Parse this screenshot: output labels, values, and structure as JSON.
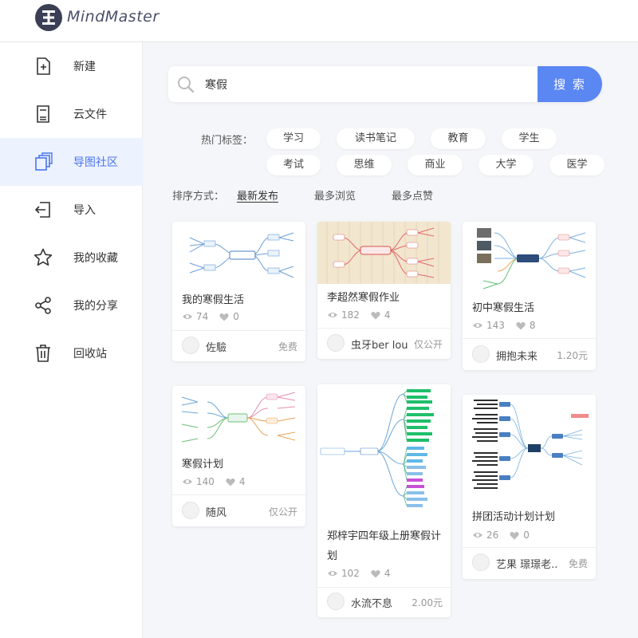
{
  "app": {
    "logo_text": "MindMaster"
  },
  "sidebar": {
    "items": [
      {
        "label": "新建",
        "icon": "new-file-icon"
      },
      {
        "label": "云文件",
        "icon": "cloud-file-icon"
      },
      {
        "label": "导图社区",
        "icon": "community-icon",
        "active": true
      },
      {
        "label": "导入",
        "icon": "import-icon"
      },
      {
        "label": "我的收藏",
        "icon": "star-icon"
      },
      {
        "label": "我的分享",
        "icon": "share-icon"
      },
      {
        "label": "回收站",
        "icon": "trash-icon"
      }
    ]
  },
  "search": {
    "value": "寒假",
    "placeholder": "",
    "button_label": "搜 索"
  },
  "tags": {
    "label": "热门标签：",
    "items": [
      "学习",
      "读书笔记",
      "教育",
      "学生",
      "考试",
      "思维",
      "商业",
      "大学",
      "医学"
    ]
  },
  "sort": {
    "label": "排序方式：",
    "options": [
      "最新发布",
      "最多浏览",
      "最多点赞"
    ],
    "active": "最新发布"
  },
  "cards": [
    {
      "title": "我的寒假生活",
      "views": "74",
      "likes": "0",
      "author": "佐驗",
      "price": "免费"
    },
    {
      "title": "李超然寒假作业",
      "views": "182",
      "likes": "4",
      "author": "虫牙ber lou .",
      "price": "仅公开"
    },
    {
      "title": "初中寒假生活",
      "views": "143",
      "likes": "8",
      "author": "拥抱未来",
      "price": "1.20元"
    },
    {
      "title": "寒假计划",
      "views": "140",
      "likes": "4",
      "author": "随风",
      "price": "仅公开"
    },
    {
      "title": "郑梓宇四年级上册寒假计划",
      "views": "102",
      "likes": "4",
      "author": "水流不息",
      "price": "2.00元"
    },
    {
      "title": "拼团活动计划计划",
      "views": "26",
      "likes": "0",
      "author": "艺果 璟璟老...",
      "price": "免费"
    }
  ],
  "colors": {
    "accent": "#5b87f3",
    "active_nav_bg": "#edf2ff",
    "active_nav_text": "#4a74ee"
  }
}
